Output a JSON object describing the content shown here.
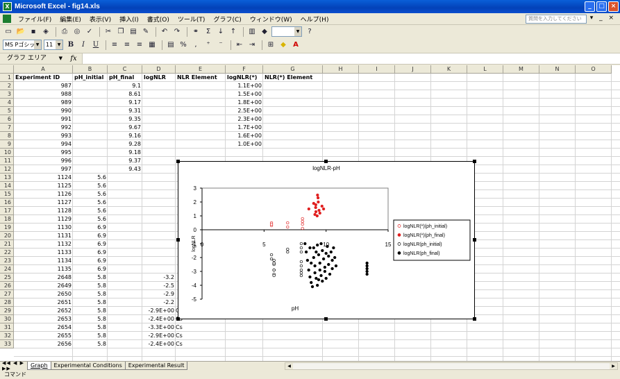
{
  "window": {
    "title": "Microsoft Excel - fig14.xls",
    "min_icon": "minimize-icon",
    "max_icon": "maximize-icon"
  },
  "menu": {
    "items": [
      "ファイル(F)",
      "編集(E)",
      "表示(V)",
      "挿入(I)",
      "書式(O)",
      "ツール(T)",
      "グラフ(C)",
      "ウィンドウ(W)",
      "ヘルプ(H)"
    ],
    "help_placeholder": "質問を入力してください",
    "doc_controls": "▾ _ ×"
  },
  "toolbar": {
    "font_name": "MS Pゴシック",
    "font_size": "11",
    "bold": "B",
    "italic": "I",
    "underline": "U",
    "percent": "%",
    "font_color": "A"
  },
  "formula_bar": {
    "name_box": "グラフ エリア",
    "fx": "fx",
    "content": ""
  },
  "columns": [
    "A",
    "B",
    "C",
    "D",
    "E",
    "F",
    "G",
    "H",
    "I",
    "J",
    "K",
    "L",
    "M",
    "N",
    "O"
  ],
  "rows": [
    "1",
    "2",
    "3",
    "4",
    "5",
    "6",
    "7",
    "8",
    "9",
    "10",
    "11",
    "12",
    "13",
    "14",
    "15",
    "16",
    "17",
    "18",
    "19",
    "20",
    "21",
    "22",
    "23",
    "24",
    "25",
    "26",
    "27",
    "28",
    "29",
    "30",
    "31",
    "32",
    "33"
  ],
  "headers": {
    "a": "Experiment ID",
    "b": "pH_initial",
    "c": "pH_final",
    "d": "logNLR",
    "e": "NLR Element",
    "f": "logNLR(*)",
    "g": "NLR(*) Element"
  },
  "table": [
    {
      "a": "987",
      "b": "",
      "c": "9.1",
      "d": "",
      "e": "",
      "f": "1.1E+00"
    },
    {
      "a": "988",
      "b": "",
      "c": "8.61",
      "d": "",
      "e": "",
      "f": "1.5E+00"
    },
    {
      "a": "989",
      "b": "",
      "c": "9.17",
      "d": "",
      "e": "",
      "f": "1.8E+00"
    },
    {
      "a": "990",
      "b": "",
      "c": "9.31",
      "d": "",
      "e": "",
      "f": "2.5E+00"
    },
    {
      "a": "991",
      "b": "",
      "c": "9.35",
      "d": "",
      "e": "",
      "f": "2.3E+00"
    },
    {
      "a": "992",
      "b": "",
      "c": "9.67",
      "d": "",
      "e": "",
      "f": "1.7E+00"
    },
    {
      "a": "993",
      "b": "",
      "c": "9.16",
      "d": "",
      "e": "",
      "f": "1.6E+00"
    },
    {
      "a": "994",
      "b": "",
      "c": "9.28",
      "d": "",
      "e": "",
      "f": "1.0E+00"
    },
    {
      "a": "995",
      "b": "",
      "c": "9.18",
      "d": "",
      "e": "",
      "f": ""
    },
    {
      "a": "996",
      "b": "",
      "c": "9.37",
      "d": "",
      "e": "",
      "f": ""
    },
    {
      "a": "997",
      "b": "",
      "c": "9.43",
      "d": "",
      "e": "",
      "f": ""
    },
    {
      "a": "1124",
      "b": "5.6",
      "c": "",
      "d": "",
      "e": "",
      "f": ""
    },
    {
      "a": "1125",
      "b": "5.6",
      "c": "",
      "d": "",
      "e": "",
      "f": ""
    },
    {
      "a": "1126",
      "b": "5.6",
      "c": "",
      "d": "",
      "e": "",
      "f": ""
    },
    {
      "a": "1127",
      "b": "5.6",
      "c": "",
      "d": "",
      "e": "",
      "f": ""
    },
    {
      "a": "1128",
      "b": "5.6",
      "c": "",
      "d": "",
      "e": "",
      "f": ""
    },
    {
      "a": "1129",
      "b": "5.6",
      "c": "",
      "d": "",
      "e": "",
      "f": ""
    },
    {
      "a": "1130",
      "b": "6.9",
      "c": "",
      "d": "",
      "e": "",
      "f": ""
    },
    {
      "a": "1131",
      "b": "6.9",
      "c": "",
      "d": "",
      "e": "",
      "f": ""
    },
    {
      "a": "1132",
      "b": "6.9",
      "c": "",
      "d": "",
      "e": "",
      "f": ""
    },
    {
      "a": "1133",
      "b": "6.9",
      "c": "",
      "d": "",
      "e": "",
      "f": ""
    },
    {
      "a": "1134",
      "b": "6.9",
      "c": "",
      "d": "",
      "e": "",
      "f": ""
    },
    {
      "a": "1135",
      "b": "6.9",
      "c": "",
      "d": "",
      "e": "",
      "f": ""
    },
    {
      "a": "2648",
      "b": "5.8",
      "c": "",
      "d": "-3.2",
      "e": "",
      "f": ""
    },
    {
      "a": "2649",
      "b": "5.8",
      "c": "",
      "d": "-2.5",
      "e": "",
      "f": ""
    },
    {
      "a": "2650",
      "b": "5.8",
      "c": "",
      "d": "-2.9",
      "e": "",
      "f": ""
    },
    {
      "a": "2651",
      "b": "5.8",
      "c": "",
      "d": "-2.2",
      "e": "",
      "f": ""
    },
    {
      "a": "2652",
      "b": "5.8",
      "c": "",
      "d": "-2.9E+00",
      "e": "Cs",
      "f": ""
    },
    {
      "a": "2653",
      "b": "5.8",
      "c": "",
      "d": "-2.4E+00",
      "e": "Cs",
      "f": ""
    },
    {
      "a": "2654",
      "b": "5.8",
      "c": "",
      "d": "-3.3E+00",
      "e": "Cs",
      "f": ""
    },
    {
      "a": "2655",
      "b": "5.8",
      "c": "",
      "d": "-2.9E+00",
      "e": "Cs",
      "f": ""
    },
    {
      "a": "2656",
      "b": "5.8",
      "c": "",
      "d": "-2.4E+00",
      "e": "Cs",
      "f": ""
    }
  ],
  "sheet_tabs": [
    "Graph",
    "Experimental Conditions",
    "Experimental Result"
  ],
  "active_tab": "Graph",
  "status": "コマンド",
  "chart_data": {
    "type": "scatter",
    "title": "logNLR-pH",
    "xlabel": "pH",
    "ylabel": "logNLR",
    "xlim": [
      0,
      15
    ],
    "ylim": [
      -5,
      3
    ],
    "xticks": [
      "0",
      "5",
      "10",
      "15"
    ],
    "yticks": [
      "3",
      "2",
      "1",
      "0",
      "-1",
      "-2",
      "-3",
      "-4",
      "-5"
    ],
    "legend_position": "right",
    "series": [
      {
        "name": "logNLR(*)(ph_initial)",
        "marker": "open",
        "color": "#e02020",
        "points": [
          [
            5.6,
            0.3
          ],
          [
            5.6,
            0.5
          ],
          [
            5.6,
            0.4
          ],
          [
            6.9,
            0.2
          ],
          [
            6.9,
            0.5
          ],
          [
            8.1,
            0.6
          ],
          [
            8.1,
            0.8
          ],
          [
            8.1,
            0.4
          ],
          [
            8.1,
            0.1
          ]
        ]
      },
      {
        "name": "logNLR(*)(ph_final)",
        "marker": "filled",
        "color": "#e02020",
        "points": [
          [
            9.1,
            1.1
          ],
          [
            8.61,
            1.5
          ],
          [
            9.17,
            1.8
          ],
          [
            9.31,
            2.5
          ],
          [
            9.35,
            2.3
          ],
          [
            9.67,
            1.7
          ],
          [
            9.16,
            1.6
          ],
          [
            9.28,
            1.0
          ],
          [
            9.18,
            1.3
          ],
          [
            9.37,
            2.0
          ],
          [
            9.43,
            1.4
          ],
          [
            9.0,
            1.9
          ],
          [
            9.5,
            1.2
          ],
          [
            9.8,
            1.5
          ]
        ]
      },
      {
        "name": "logNLR(ph_initial)",
        "marker": "open",
        "color": "#000000",
        "points": [
          [
            5.6,
            -1.8
          ],
          [
            5.6,
            -2.1
          ],
          [
            5.8,
            -3.2
          ],
          [
            5.8,
            -2.5
          ],
          [
            5.8,
            -2.9
          ],
          [
            5.8,
            -2.2
          ],
          [
            5.8,
            -2.9
          ],
          [
            5.8,
            -2.4
          ],
          [
            5.8,
            -3.3
          ],
          [
            5.8,
            -2.9
          ],
          [
            5.8,
            -2.4
          ],
          [
            6.9,
            -1.4
          ],
          [
            6.9,
            -1.6
          ],
          [
            8.0,
            -1.0
          ],
          [
            8.0,
            -1.3
          ],
          [
            8.0,
            -1.6
          ],
          [
            8.0,
            -2.3
          ],
          [
            8.0,
            -2.6
          ],
          [
            8.0,
            -2.9
          ],
          [
            8.0,
            -3.1
          ],
          [
            8.0,
            -3.3
          ]
        ]
      },
      {
        "name": "logNLR(ph_final)",
        "marker": "filled",
        "color": "#000000",
        "points": [
          [
            8.3,
            -1.0
          ],
          [
            8.4,
            -1.6
          ],
          [
            8.5,
            -2.2
          ],
          [
            8.6,
            -2.9
          ],
          [
            8.7,
            -3.4
          ],
          [
            8.8,
            -3.8
          ],
          [
            8.9,
            -4.1
          ],
          [
            9.0,
            -1.3
          ],
          [
            9.0,
            -2.0
          ],
          [
            9.1,
            -2.6
          ],
          [
            9.1,
            -3.1
          ],
          [
            9.2,
            -3.5
          ],
          [
            9.3,
            -4.0
          ],
          [
            9.3,
            -1.1
          ],
          [
            9.4,
            -1.8
          ],
          [
            9.5,
            -2.4
          ],
          [
            9.5,
            -2.9
          ],
          [
            9.6,
            -3.3
          ],
          [
            9.7,
            -3.7
          ],
          [
            9.7,
            -1.5
          ],
          [
            9.8,
            -2.1
          ],
          [
            9.9,
            -2.7
          ],
          [
            9.9,
            -3.0
          ],
          [
            10.0,
            -3.5
          ],
          [
            10.1,
            -1.2
          ],
          [
            10.2,
            -1.9
          ],
          [
            10.2,
            -2.5
          ],
          [
            10.3,
            -3.2
          ],
          [
            10.4,
            -1.6
          ],
          [
            10.5,
            -2.2
          ],
          [
            10.5,
            -2.8
          ],
          [
            10.6,
            -1.3
          ],
          [
            10.7,
            -2.0
          ],
          [
            10.8,
            -2.6
          ],
          [
            8.7,
            -1.3
          ],
          [
            8.8,
            -2.4
          ],
          [
            9.2,
            -1.6
          ],
          [
            9.6,
            -1.0
          ],
          [
            10.0,
            -1.7
          ],
          [
            9.4,
            -3.6
          ],
          [
            13.3,
            -2.4
          ],
          [
            13.3,
            -2.6
          ],
          [
            13.3,
            -2.8
          ],
          [
            13.3,
            -3.0
          ],
          [
            13.3,
            -3.2
          ]
        ]
      }
    ]
  }
}
